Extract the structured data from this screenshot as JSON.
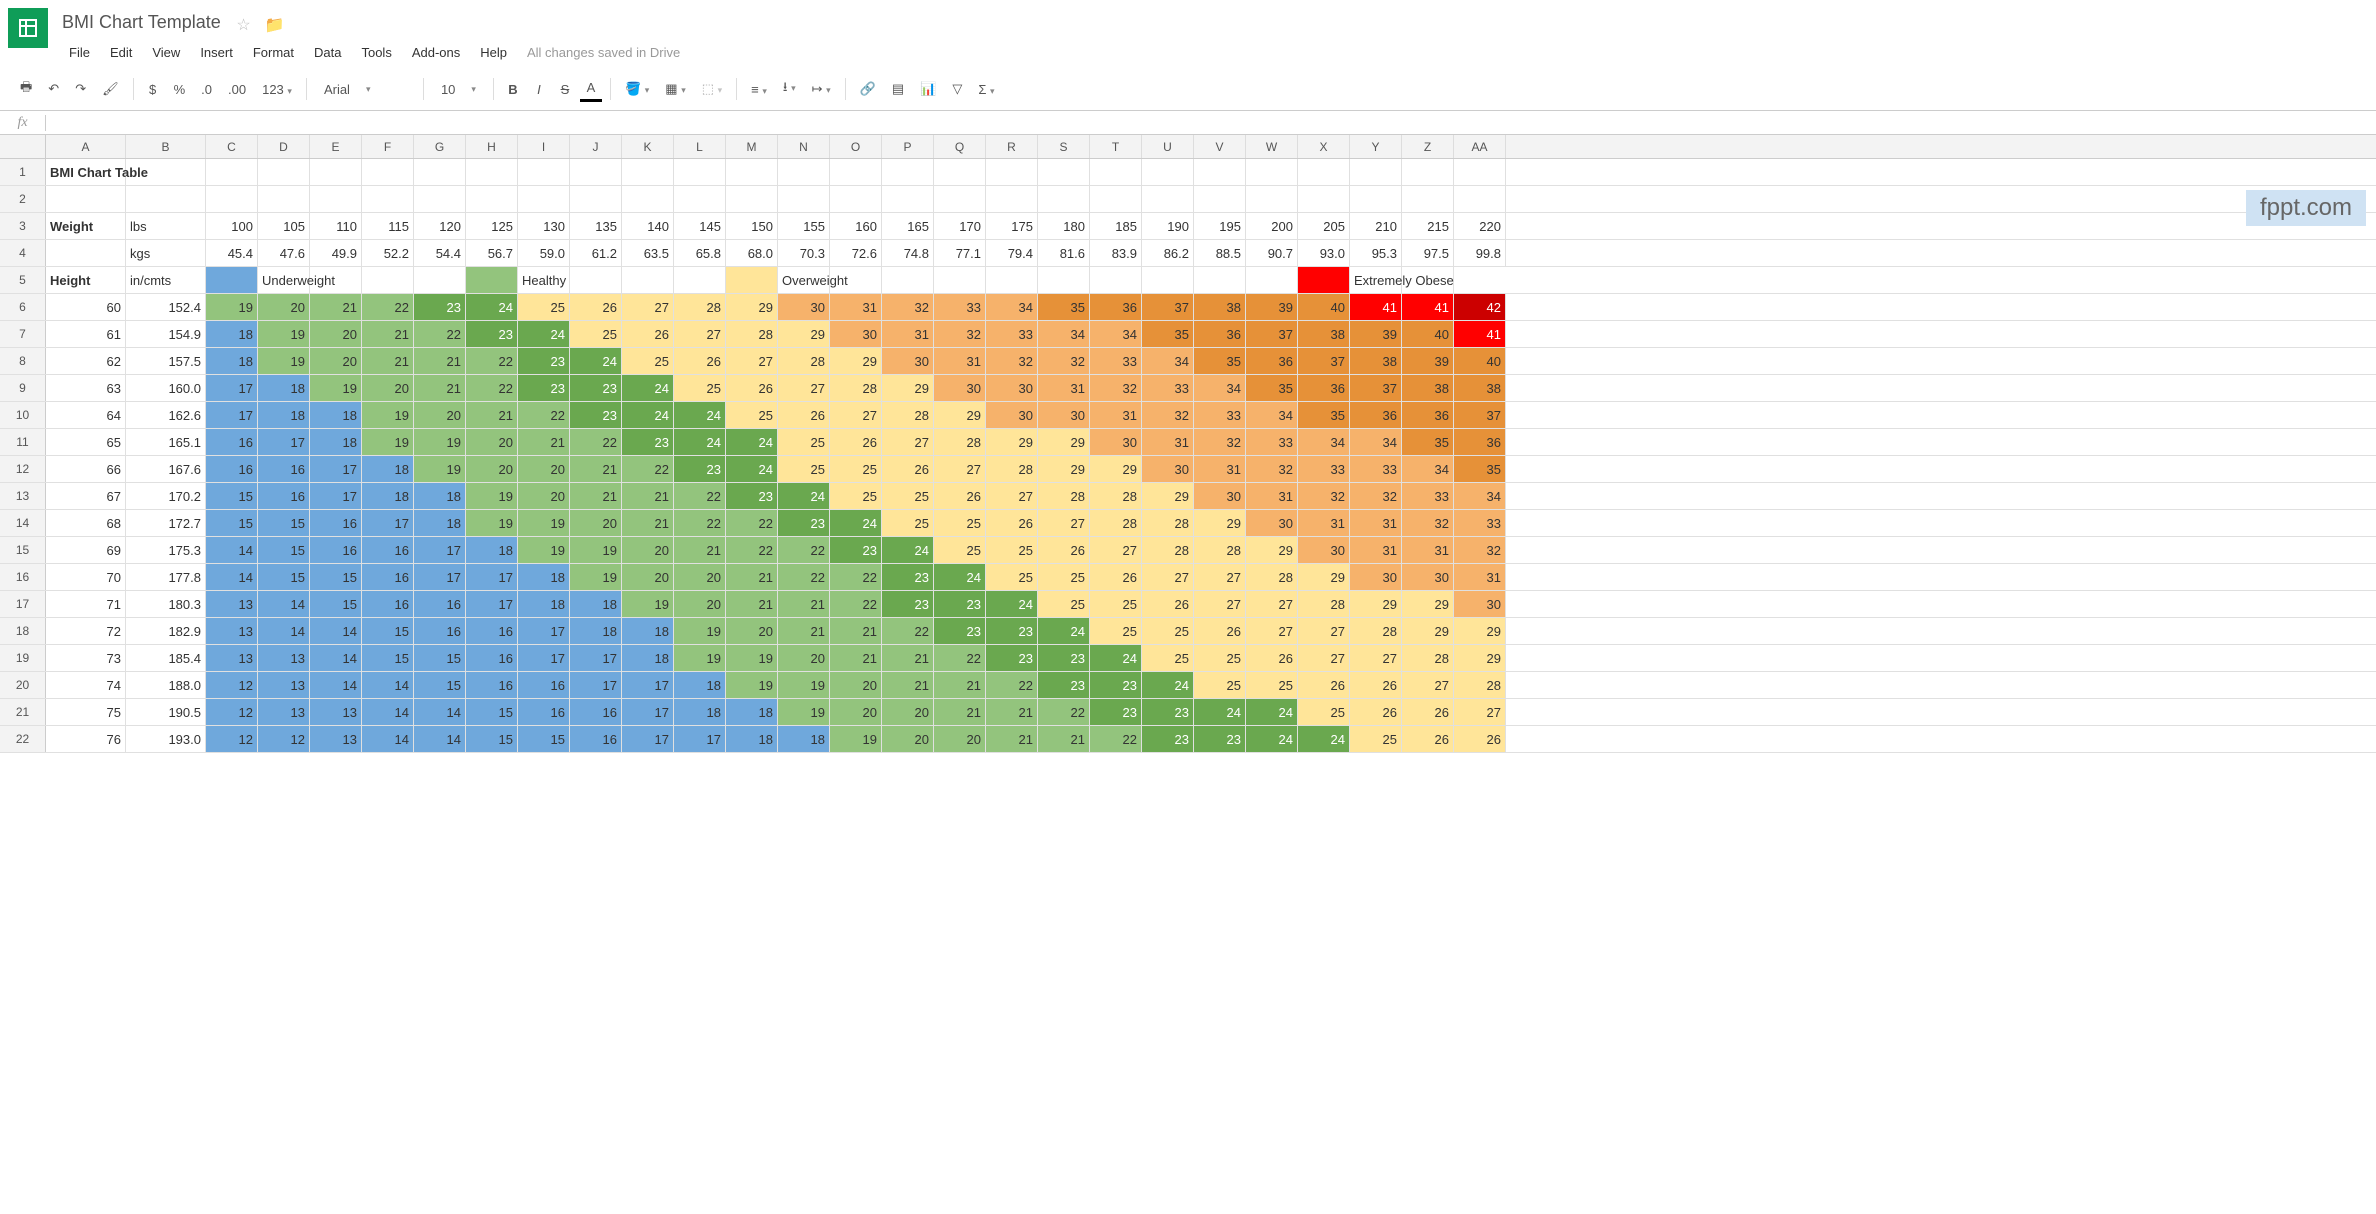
{
  "doc_title": "BMI Chart Template",
  "save_status": "All changes saved in Drive",
  "watermark": "fppt.com",
  "menu": [
    "File",
    "Edit",
    "View",
    "Insert",
    "Format",
    "Data",
    "Tools",
    "Add-ons",
    "Help"
  ],
  "toolbar": {
    "font": "Arial",
    "size": "10"
  },
  "cols": [
    "A",
    "B",
    "C",
    "D",
    "E",
    "F",
    "G",
    "H",
    "I",
    "J",
    "K",
    "L",
    "M",
    "N",
    "O",
    "P",
    "Q",
    "R",
    "S",
    "T",
    "U",
    "V",
    "W",
    "X",
    "Y",
    "Z",
    "AA"
  ],
  "labels": {
    "table_title": "BMI Chart Table",
    "weight": "Weight",
    "lbs": "lbs",
    "kgs": "kgs",
    "height": "Height",
    "incmts": "in/cmts",
    "underweight": "Underweight",
    "healthy": "Healthy",
    "overweight": "Overweight",
    "extreme": "Extremely Obese"
  },
  "lbs": [
    100,
    105,
    110,
    115,
    120,
    125,
    130,
    135,
    140,
    145,
    150,
    155,
    160,
    165,
    170,
    175,
    180,
    185,
    190,
    195,
    200,
    205,
    210,
    215,
    220
  ],
  "kgs": [
    "45.4",
    "47.6",
    "49.9",
    "52.2",
    "54.4",
    "56.7",
    "59.0",
    "61.2",
    "63.5",
    "65.8",
    "68.0",
    "70.3",
    "72.6",
    "74.8",
    "77.1",
    "79.4",
    "81.6",
    "83.9",
    "86.2",
    "88.5",
    "90.7",
    "93.0",
    "95.3",
    "97.5",
    "99.8"
  ],
  "heights_in": [
    60,
    61,
    62,
    63,
    64,
    65,
    66,
    67,
    68,
    69,
    70,
    71,
    72,
    73,
    74,
    75,
    76
  ],
  "heights_cm": [
    "152.4",
    "154.9",
    "157.5",
    "160.0",
    "162.6",
    "165.1",
    "167.6",
    "170.2",
    "172.7",
    "175.3",
    "177.8",
    "180.3",
    "182.9",
    "185.4",
    "188.0",
    "190.5",
    "193.0"
  ],
  "bmi": [
    [
      19,
      20,
      21,
      22,
      23,
      24,
      25,
      26,
      27,
      28,
      29,
      30,
      31,
      32,
      33,
      34,
      35,
      36,
      37,
      38,
      39,
      40,
      41,
      41,
      42
    ],
    [
      18,
      19,
      20,
      21,
      22,
      23,
      24,
      25,
      26,
      27,
      28,
      29,
      30,
      31,
      32,
      33,
      34,
      34,
      35,
      36,
      37,
      38,
      39,
      40,
      41
    ],
    [
      18,
      19,
      20,
      21,
      21,
      22,
      23,
      24,
      25,
      26,
      27,
      28,
      29,
      30,
      31,
      32,
      32,
      33,
      34,
      35,
      36,
      37,
      38,
      39,
      40
    ],
    [
      17,
      18,
      19,
      20,
      21,
      22,
      23,
      23,
      24,
      25,
      26,
      27,
      28,
      29,
      30,
      30,
      31,
      32,
      33,
      34,
      35,
      36,
      37,
      38,
      38
    ],
    [
      17,
      18,
      18,
      19,
      20,
      21,
      22,
      23,
      24,
      24,
      25,
      26,
      27,
      28,
      29,
      30,
      30,
      31,
      32,
      33,
      34,
      35,
      36,
      36,
      37
    ],
    [
      16,
      17,
      18,
      19,
      19,
      20,
      21,
      22,
      23,
      24,
      24,
      25,
      26,
      27,
      28,
      29,
      29,
      30,
      31,
      32,
      33,
      34,
      34,
      35,
      36
    ],
    [
      16,
      16,
      17,
      18,
      19,
      20,
      20,
      21,
      22,
      23,
      24,
      25,
      25,
      26,
      27,
      28,
      29,
      29,
      30,
      31,
      32,
      33,
      33,
      34,
      35
    ],
    [
      15,
      16,
      17,
      18,
      18,
      19,
      20,
      21,
      21,
      22,
      23,
      24,
      25,
      25,
      26,
      27,
      28,
      28,
      29,
      30,
      31,
      32,
      32,
      33,
      34
    ],
    [
      15,
      15,
      16,
      17,
      18,
      19,
      19,
      20,
      21,
      22,
      22,
      23,
      24,
      25,
      25,
      26,
      27,
      28,
      28,
      29,
      30,
      31,
      31,
      32,
      33
    ],
    [
      14,
      15,
      16,
      16,
      17,
      18,
      19,
      19,
      20,
      21,
      22,
      22,
      23,
      24,
      25,
      25,
      26,
      27,
      28,
      28,
      29,
      30,
      31,
      31,
      32
    ],
    [
      14,
      15,
      15,
      16,
      17,
      17,
      18,
      19,
      20,
      20,
      21,
      22,
      22,
      23,
      24,
      25,
      25,
      26,
      27,
      27,
      28,
      29,
      30,
      30,
      31
    ],
    [
      13,
      14,
      15,
      16,
      16,
      17,
      18,
      18,
      19,
      20,
      21,
      21,
      22,
      23,
      23,
      24,
      25,
      25,
      26,
      27,
      27,
      28,
      29,
      29,
      30
    ],
    [
      13,
      14,
      14,
      15,
      16,
      16,
      17,
      18,
      18,
      19,
      20,
      21,
      21,
      22,
      23,
      23,
      24,
      25,
      25,
      26,
      27,
      27,
      28,
      29,
      29
    ],
    [
      13,
      13,
      14,
      15,
      15,
      16,
      17,
      17,
      18,
      19,
      19,
      20,
      21,
      21,
      22,
      23,
      23,
      24,
      25,
      25,
      26,
      27,
      27,
      28,
      29
    ],
    [
      12,
      13,
      14,
      14,
      15,
      16,
      16,
      17,
      17,
      18,
      19,
      19,
      20,
      21,
      21,
      22,
      23,
      23,
      24,
      25,
      25,
      26,
      26,
      27,
      28
    ],
    [
      12,
      13,
      13,
      14,
      14,
      15,
      16,
      16,
      17,
      18,
      18,
      19,
      20,
      20,
      21,
      21,
      22,
      23,
      23,
      24,
      24,
      25,
      26,
      26,
      27
    ],
    [
      12,
      12,
      13,
      14,
      14,
      15,
      15,
      16,
      17,
      17,
      18,
      18,
      19,
      20,
      20,
      21,
      21,
      22,
      23,
      23,
      24,
      24,
      25,
      26,
      26
    ]
  ]
}
